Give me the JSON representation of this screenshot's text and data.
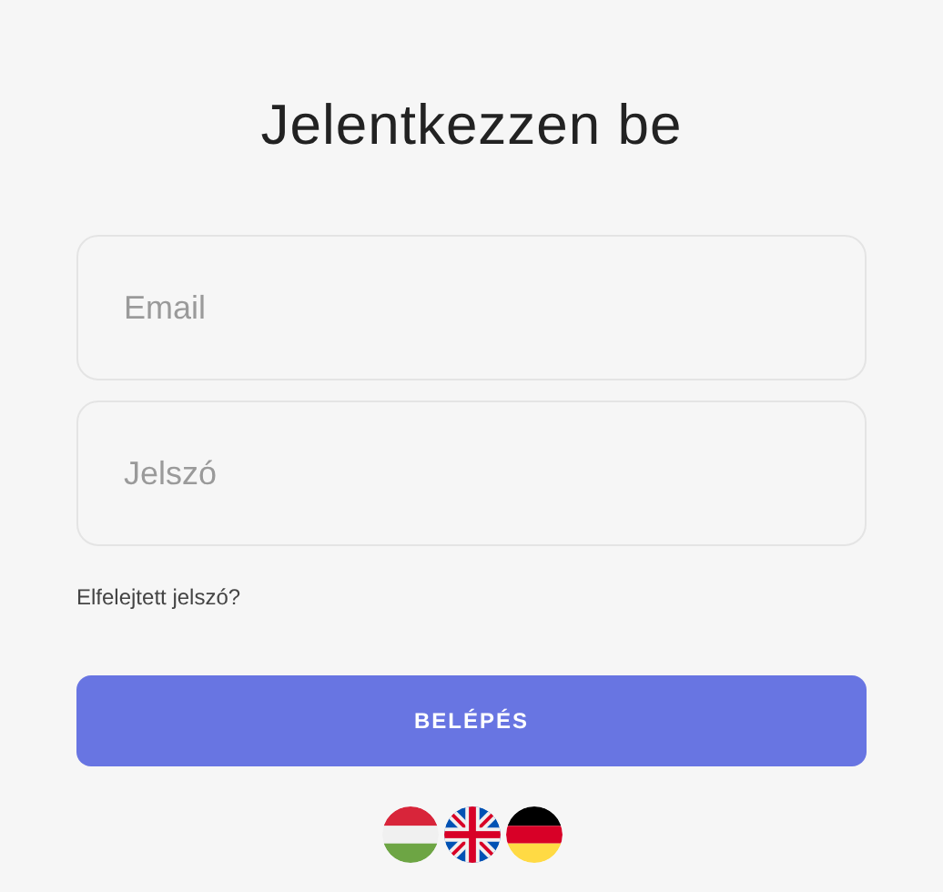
{
  "title": "Jelentkezzen be",
  "fields": [
    {
      "placeholder": "Email"
    },
    {
      "placeholder": "Jelszó"
    }
  ],
  "forgot_link": "Elfelejtett jelszó?",
  "submit_button": "BELÉPÉS",
  "languages": [
    {
      "kind": "hu"
    },
    {
      "kind": "gb"
    },
    {
      "kind": "de"
    }
  ]
}
